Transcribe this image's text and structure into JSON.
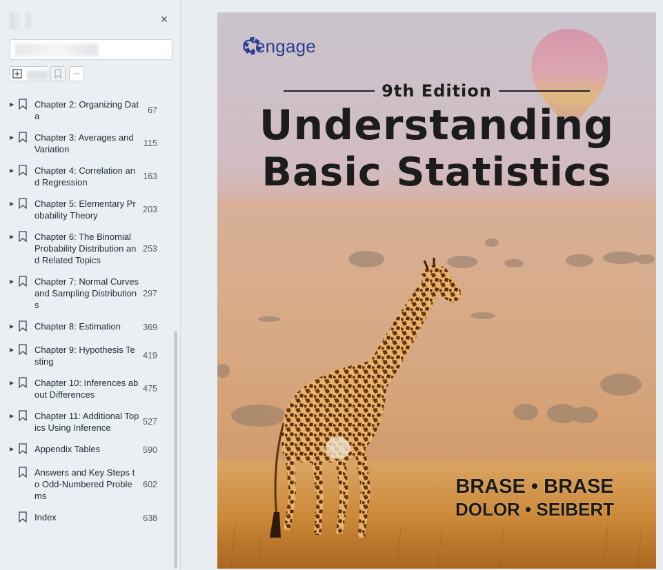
{
  "sidebar": {
    "search": {
      "value": "",
      "placeholder": ""
    },
    "close_icon": "×",
    "more_icon": "···",
    "toc": [
      {
        "label": "Chapter 2: Organizing Data",
        "page": "67",
        "expandable": true
      },
      {
        "label": "Chapter 3: Averages and Variation",
        "page": "115",
        "expandable": true
      },
      {
        "label": "Chapter 4: Correlation and Regression",
        "page": "163",
        "expandable": true
      },
      {
        "label": "Chapter 5: Elementary Probability Theory",
        "page": "203",
        "expandable": true
      },
      {
        "label": "Chapter 6: The Binomial Probability Distribution and Related Topics",
        "page": "253",
        "expandable": true
      },
      {
        "label": "Chapter 7: Normal Curves and Sampling Distributions",
        "page": "297",
        "expandable": true
      },
      {
        "label": "Chapter 8: Estimation",
        "page": "369",
        "expandable": true
      },
      {
        "label": "Chapter 9: Hypothesis Testing",
        "page": "419",
        "expandable": true
      },
      {
        "label": "Chapter 10: Inferences about Differences",
        "page": "475",
        "expandable": true
      },
      {
        "label": "Chapter 11:  Additional Topics Using Inference",
        "page": "527",
        "expandable": true
      },
      {
        "label": "Appendix Tables",
        "page": "590",
        "expandable": true
      },
      {
        "label": "Answers and Key Steps to Odd-Numbered Problems",
        "page": "602",
        "expandable": false
      },
      {
        "label": "Index",
        "page": "638",
        "expandable": false
      }
    ]
  },
  "cover": {
    "publisher": "Cengage",
    "edition": "9th Edition",
    "title_line1": "Understanding",
    "title_line2": "Basic Statistics",
    "authors_line1": "BRASE • BRASE",
    "authors_line2": "DOLOR • SEIBERT"
  }
}
